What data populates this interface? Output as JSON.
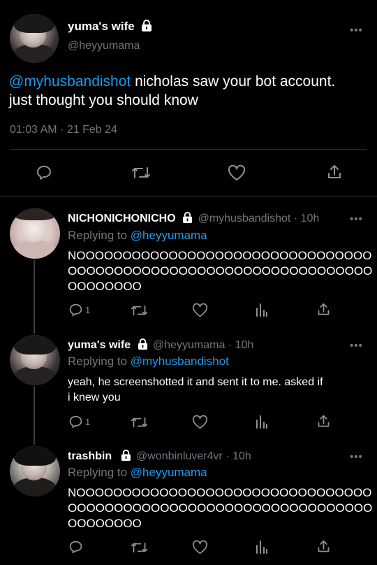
{
  "main_tweet": {
    "display_name": "yuma's wife",
    "handle": "@heyyumama",
    "mention": "@myhusbandishot",
    "text_line1_rest": " nicholas saw your bot account.",
    "text_line2": "just thought you should know",
    "timestamp": "01:03 AM · 21 Feb 24"
  },
  "replies": [
    {
      "display_name": "NICHONICHONICHO",
      "meta": "@myhusbandishot · 10h",
      "replying_label": "Replying to ",
      "replying_handle": "@heyyumama",
      "lines": [
        "NOOOOOOOOOOOOOOOOOOOOOOOOOOOOOOOO",
        "OOOOOOOOOOOOOOOOOOOOOOOOOOOOOOOOO",
        "OOOOOOOO"
      ],
      "reply_count": "1"
    },
    {
      "display_name": "yuma's wife",
      "meta": "@heyyumama · 10h",
      "replying_label": "Replying to ",
      "replying_handle": "@myhusbandishot",
      "lines": [
        "yeah, he screenshotted it and sent it to me. asked if",
        "i knew you"
      ],
      "reply_count": "1"
    },
    {
      "display_name": "trashbin",
      "meta": "@wonbinluver4vr · 10h",
      "replying_label": "Replying to ",
      "replying_handle": "@heyyumama",
      "lines": [
        "NOOOOOOOOOOOOOOOOOOOOOOOOOOOOOOOO",
        "OOOOOOOOOOOOOOOOOOOOOOOOOOOOOOOOO",
        "OOOOOOOO"
      ],
      "reply_count": ""
    }
  ],
  "more_glyph": "•••",
  "colors": {
    "accent": "#1d9bf0",
    "secondary_text": "#71767b",
    "divider": "#2f3336"
  }
}
